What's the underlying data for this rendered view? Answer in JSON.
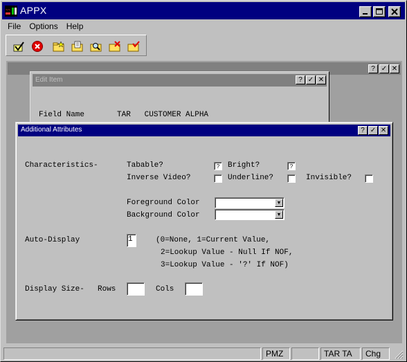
{
  "window": {
    "title": "APPX"
  },
  "menu": [
    "File",
    "Options",
    "Help"
  ],
  "toolbar": {
    "icons": [
      "checkmark-icon",
      "cancel-icon",
      "folder-new-icon",
      "folder-edit-icon",
      "folder-search-icon",
      "folder-delete-icon",
      "folder-check-icon"
    ]
  },
  "mdi": {
    "buttons": [
      "?",
      "✓",
      "✕"
    ]
  },
  "edit_item": {
    "title": "Edit Item",
    "field_name_label": "Field Name",
    "field_value": "TAR   CUSTOMER ALPHA"
  },
  "attr_dialog": {
    "title": "Additional Attributes",
    "characteristics_label": "Characteristics-",
    "tabable_label": "Tabable?",
    "tabable_value": "?",
    "bright_label": "Bright?",
    "bright_value": "?",
    "inverse_label": "Inverse Video?",
    "underline_label": "Underline?",
    "invisible_label": "Invisible?",
    "fg_label": "Foreground Color",
    "bg_label": "Background Color",
    "fg_value": "",
    "bg_value": "",
    "auto_display_label": "Auto-Display",
    "auto_display_value": "1",
    "auto_help_1": "(0=None, 1=Current Value,",
    "auto_help_2": "2=Lookup Value - Null If NOF,",
    "auto_help_3": "3=Lookup Value - '?' If NOF)",
    "display_size_label": "Display Size-",
    "rows_label": "Rows",
    "rows_value": "",
    "cols_label": "Cols",
    "cols_value": ""
  },
  "status": {
    "panels": [
      "",
      "PMZ",
      "",
      "TAR TA",
      "Chg"
    ]
  }
}
